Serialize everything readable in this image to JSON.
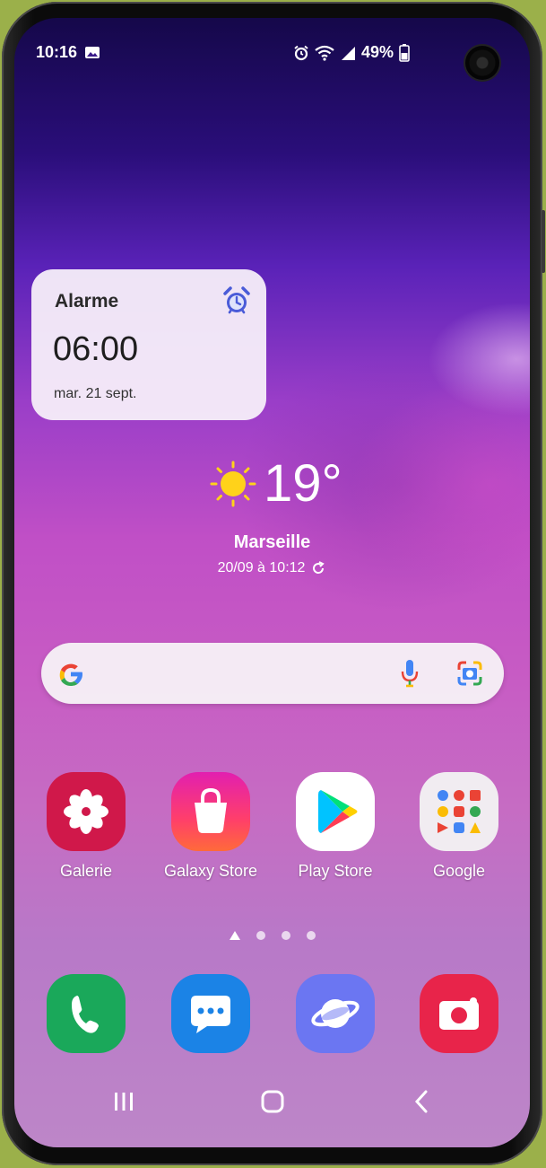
{
  "status_bar": {
    "time": "10:16",
    "battery": "49%"
  },
  "alarm_widget": {
    "title": "Alarme",
    "time": "06:00",
    "date": "mar. 21 sept."
  },
  "weather": {
    "temperature": "19°",
    "city": "Marseille",
    "updated": "20/09 à 10:12"
  },
  "search": {
    "placeholder": ""
  },
  "apps": [
    {
      "label": "Galerie",
      "color": "#d0184a"
    },
    {
      "label": "Galaxy Store",
      "color": "#ff2a7a"
    },
    {
      "label": "Play Store",
      "color": "#ffffff"
    },
    {
      "label": "Google",
      "color": "#f1ecf1"
    }
  ],
  "dock": [
    {
      "name": "phone",
      "color": "#1aa85a"
    },
    {
      "name": "messages",
      "color": "#1b83e6"
    },
    {
      "name": "internet",
      "color": "#6b76f2"
    },
    {
      "name": "camera",
      "color": "#e8244a"
    }
  ],
  "page_indicator": {
    "pages": 4,
    "current": 1
  },
  "colors": {
    "accent_alarm": "#4a5bd8",
    "sun": "#ffd21a"
  }
}
